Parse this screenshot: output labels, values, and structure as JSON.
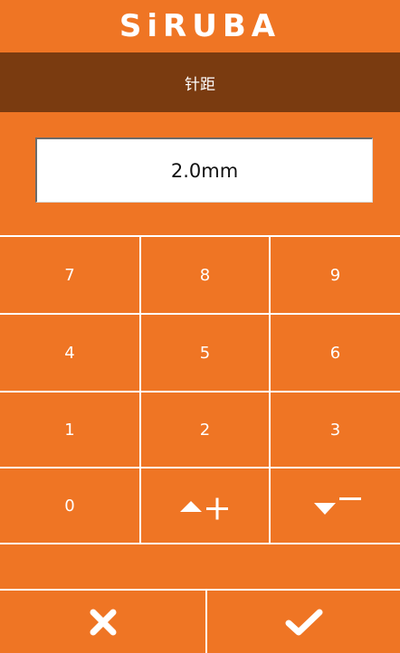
{
  "header": {
    "logo_text": "SiRUBA",
    "title": "针距"
  },
  "display": {
    "value": "2.0mm"
  },
  "keypad": {
    "keys": [
      "7",
      "8",
      "9",
      "4",
      "5",
      "6",
      "1",
      "2",
      "3",
      "0"
    ]
  },
  "actions": {
    "cancel_icon": "close-icon",
    "confirm_icon": "check-icon"
  },
  "colors": {
    "background": "#ef7524",
    "title_bar": "#7a3b10",
    "foreground": "#ffffff"
  }
}
